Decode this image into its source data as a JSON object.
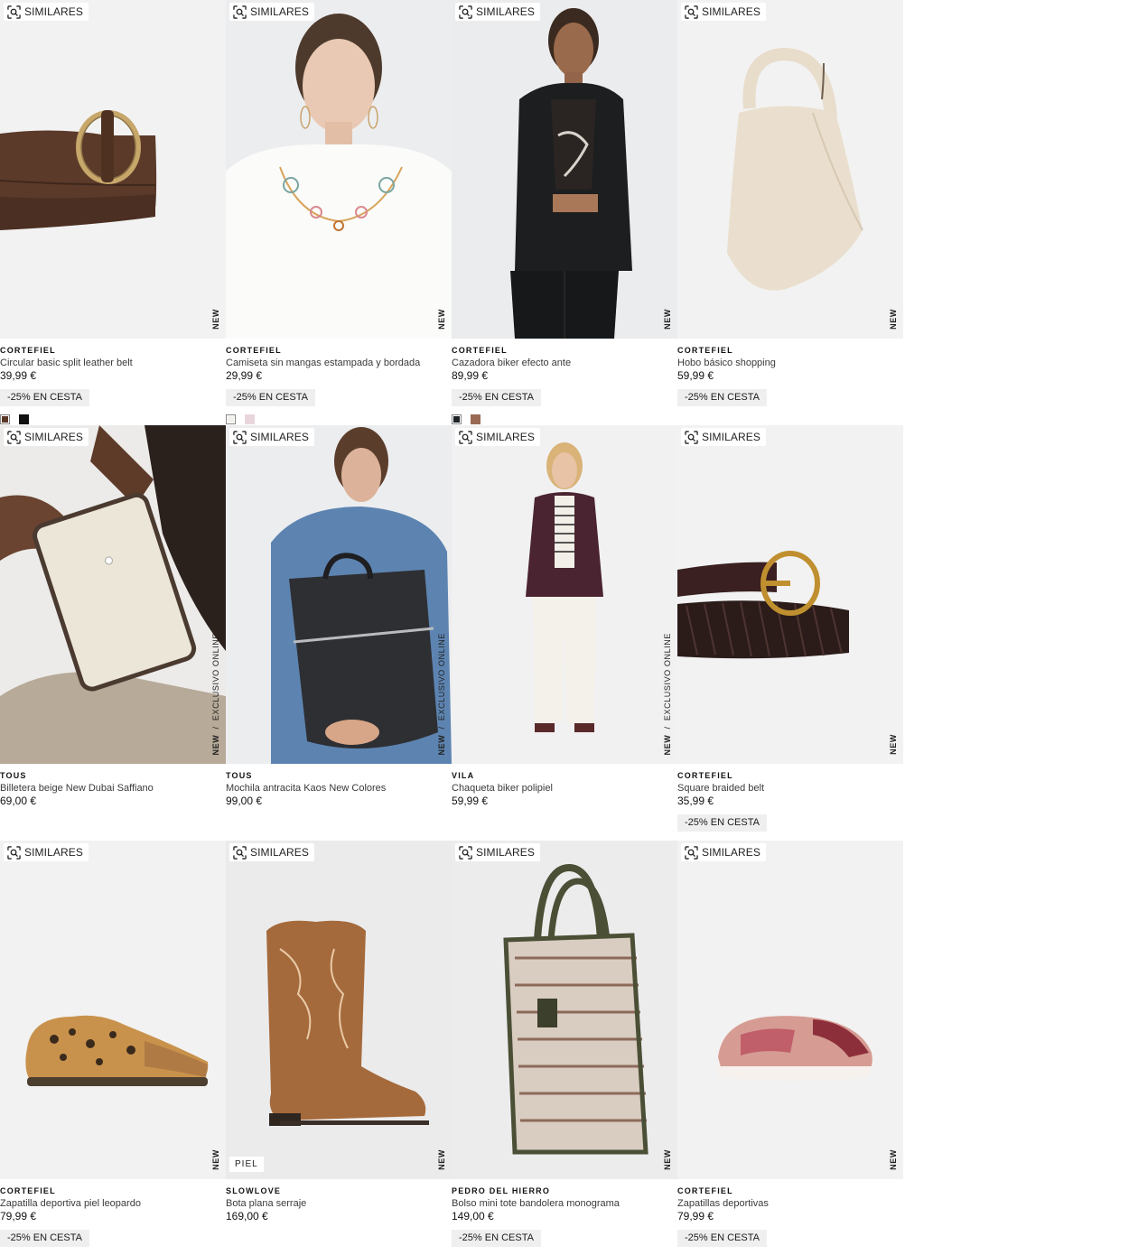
{
  "similar_label": "SIMILARES",
  "products": [
    {
      "brand": "CORTEFIEL",
      "name": "Circular basic split leather belt",
      "price": "39,99 €",
      "promo": "-25% EN CESTA",
      "tag": "NEW",
      "tag2": "",
      "swatches": [
        "#5a3626",
        "#111111"
      ],
      "image": "brown-belt"
    },
    {
      "brand": "CORTEFIEL",
      "name": "Camiseta sin mangas estampada y bordada",
      "price": "29,99 €",
      "promo": "-25% EN CESTA",
      "tag": "NEW",
      "tag2": "",
      "swatches": [
        "#f2f0ea",
        "#e9d6dc"
      ],
      "image": "embroidered-top"
    },
    {
      "brand": "CORTEFIEL",
      "name": "Cazadora biker efecto ante",
      "price": "89,99 €",
      "promo": "-25% EN CESTA",
      "tag": "NEW",
      "tag2": "",
      "swatches": [
        "#1e2225",
        "#9a6a55"
      ],
      "image": "biker-jacket"
    },
    {
      "brand": "CORTEFIEL",
      "name": "Hobo básico shopping",
      "price": "59,99 €",
      "promo": "-25% EN CESTA",
      "tag": "NEW",
      "tag2": "",
      "swatches": [],
      "image": "hobo-bag"
    },
    {
      "brand": "TOUS",
      "name": "Billetera beige New Dubai Saffiano",
      "price": "69,00 €",
      "promo": "",
      "tag": "NEW",
      "tag2": "EXCLUSIVO ONLINE",
      "swatches": [],
      "image": "wallet"
    },
    {
      "brand": "TOUS",
      "name": "Mochila antracita Kaos New Colores",
      "price": "99,00 €",
      "promo": "",
      "tag": "NEW",
      "tag2": "EXCLUSIVO ONLINE",
      "swatches": [],
      "image": "backpack"
    },
    {
      "brand": "VILA",
      "name": "Chaqueta biker polipiel",
      "price": "59,99 €",
      "promo": "",
      "tag": "NEW",
      "tag2": "EXCLUSIVO ONLINE",
      "swatches": [],
      "image": "leather-jacket"
    },
    {
      "brand": "CORTEFIEL",
      "name": "Square braided belt",
      "price": "35,99 €",
      "promo": "-25% EN CESTA",
      "tag": "NEW",
      "tag2": "",
      "swatches": [],
      "image": "braided-belt"
    },
    {
      "brand": "CORTEFIEL",
      "name": "Zapatilla deportiva piel leopardo",
      "price": "79,99 €",
      "promo": "-25% EN CESTA",
      "tag": "NEW",
      "tag2": "",
      "swatches": [],
      "image": "leopard-sneaker"
    },
    {
      "brand": "SLOWLOVE",
      "name": "Bota plana serraje",
      "price": "169,00 €",
      "promo": "",
      "tag": "NEW",
      "tag2": "",
      "badge": "PIEL",
      "swatches": [],
      "image": "cowboy-boot"
    },
    {
      "brand": "PEDRO DEL HIERRO",
      "name": "Bolso mini tote bandolera monograma",
      "price": "149,00 €",
      "promo": "-25% EN CESTA",
      "tag": "NEW",
      "tag2": "",
      "swatches": [],
      "image": "monogram-tote"
    },
    {
      "brand": "CORTEFIEL",
      "name": "Zapatillas deportivas",
      "price": "79,99 €",
      "promo": "-25% EN CESTA",
      "tag": "NEW",
      "tag2": "",
      "swatches": [],
      "image": "pink-sneaker"
    }
  ]
}
